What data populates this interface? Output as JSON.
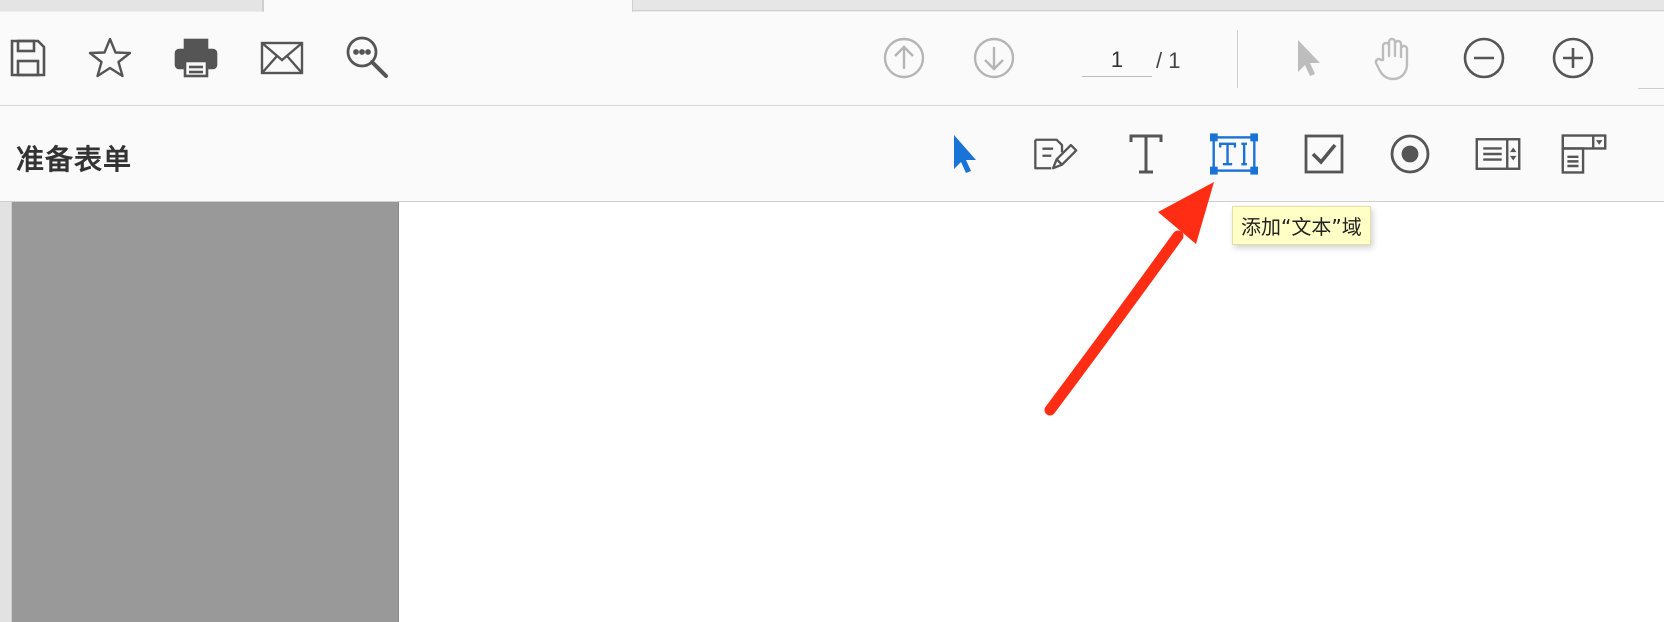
{
  "window": {
    "tabs": [
      {
        "label": "",
        "active": false
      },
      {
        "label": "",
        "active": true
      },
      {
        "label": "",
        "active": false
      }
    ]
  },
  "toolbar": {
    "left_icons": [
      "save-icon",
      "bookmark-star-icon",
      "print-icon",
      "email-icon",
      "search-comment-icon"
    ],
    "navigation": {
      "prev_page_icon": "arrow-up-circle-icon",
      "next_page_icon": "arrow-down-circle-icon",
      "current_page": "1",
      "total_pages": "/ 1"
    },
    "tools": [
      "select-arrow-icon",
      "hand-icon",
      "zoom-out-icon",
      "zoom-in-icon"
    ]
  },
  "form_toolbar": {
    "title": "准备表单",
    "tools": [
      {
        "icon": "select-arrow-icon",
        "active": true
      },
      {
        "icon": "edit-form-icon"
      },
      {
        "icon": "text-icon"
      },
      {
        "icon": "text-field-icon",
        "hovered": true
      },
      {
        "icon": "checkbox-icon"
      },
      {
        "icon": "radio-button-icon"
      },
      {
        "icon": "list-box-icon"
      },
      {
        "icon": "dropdown-icon"
      }
    ],
    "tooltip": "添加“文本”域"
  },
  "annotation": {
    "arrow_color": "#ff2d14"
  },
  "colors": {
    "accent": "#1a73d6",
    "toolbar_bg": "#fafafa",
    "gray_panel": "#999999",
    "tooltip_bg": "#ffffc6"
  }
}
